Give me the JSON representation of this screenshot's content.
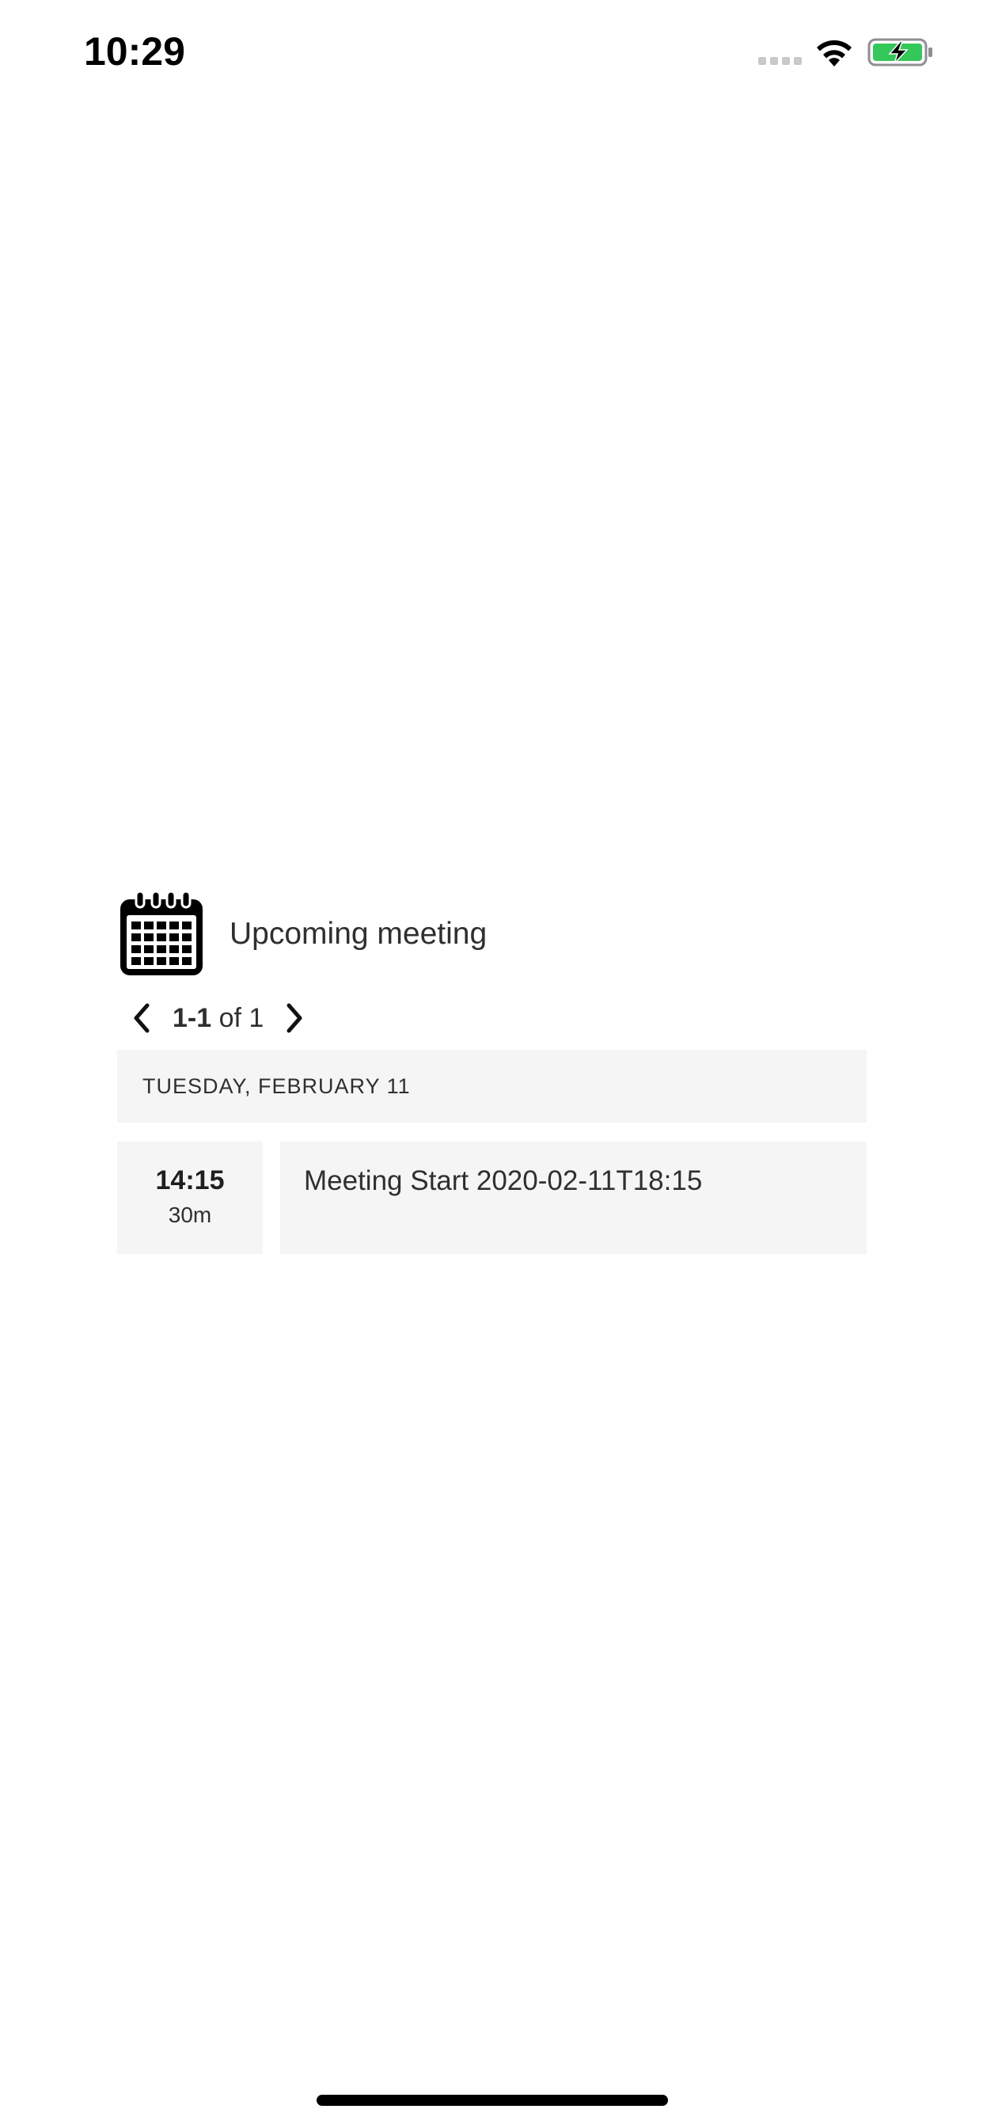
{
  "status_bar": {
    "time": "10:29",
    "wifi_icon": "wifi-icon",
    "battery_icon": "battery-charging-icon",
    "battery_color": "#34c759"
  },
  "widget": {
    "icon": "calendar-icon",
    "title": "Upcoming meeting",
    "pager": {
      "range": "1-1",
      "of_label": "of 1",
      "prev_icon": "chevron-left-icon",
      "next_icon": "chevron-right-icon"
    },
    "day_header": "TUESDAY, FEBRUARY 11",
    "events": [
      {
        "time": "14:15",
        "duration": "30m",
        "title": "Meeting Start 2020-02-11T18:15"
      }
    ],
    "panel_color": "#f5f5f5"
  }
}
